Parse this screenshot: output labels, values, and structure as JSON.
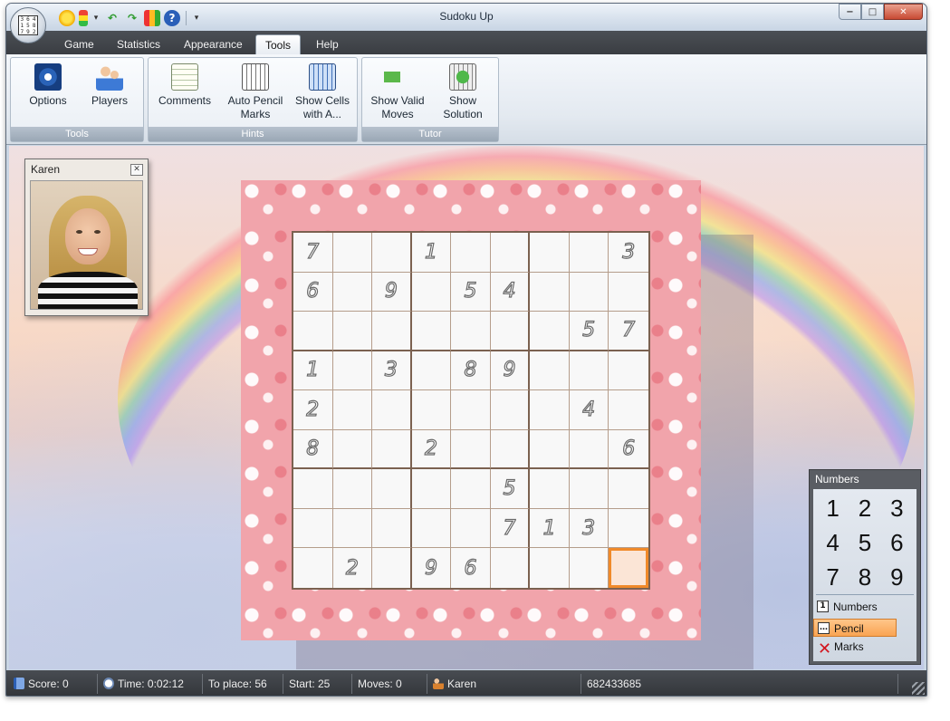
{
  "app": {
    "title": "Sudoku Up"
  },
  "quick_access": [
    "sun-icon",
    "traffic-light-icon",
    "dropdown-arrow-icon",
    "undo-icon",
    "redo-icon",
    "chart-icon",
    "help-icon",
    "customize-icon"
  ],
  "menu": {
    "tabs": [
      "Game",
      "Statistics",
      "Appearance",
      "Tools",
      "Help"
    ],
    "active": "Tools"
  },
  "ribbon": {
    "groups": [
      {
        "label": "Tools",
        "buttons": [
          {
            "label": "Options",
            "icon": "gear-icon"
          },
          {
            "label": "Players",
            "icon": "players-icon"
          }
        ]
      },
      {
        "label": "Hints",
        "buttons": [
          {
            "label": "Comments",
            "icon": "notepad-icon"
          },
          {
            "label": "Auto Pencil Marks",
            "icon": "pencil-grid-icon"
          },
          {
            "label": "Show Cells with A...",
            "icon": "cells-grid-icon"
          }
        ]
      },
      {
        "label": "Tutor",
        "buttons": [
          {
            "label": "Show Valid Moves",
            "icon": "arrow-icon"
          },
          {
            "label": "Show Solution",
            "icon": "solution-icon"
          }
        ]
      }
    ]
  },
  "player": {
    "name": "Karen"
  },
  "board": {
    "rows": [
      [
        "7",
        "",
        "",
        "1",
        "",
        "",
        "",
        "",
        "3"
      ],
      [
        "6",
        "",
        "9",
        "",
        "5",
        "4",
        "",
        "",
        ""
      ],
      [
        "",
        "",
        "",
        "",
        "",
        "",
        "",
        "5",
        "7"
      ],
      [
        "1",
        "",
        "3",
        "",
        "8",
        "9",
        "",
        "",
        ""
      ],
      [
        "2",
        "",
        "",
        "",
        "",
        "",
        "",
        "4",
        ""
      ],
      [
        "8",
        "",
        "",
        "2",
        "",
        "",
        "",
        "",
        "6"
      ],
      [
        "",
        "",
        "",
        "",
        "",
        "5",
        "",
        "",
        ""
      ],
      [
        "",
        "",
        "",
        "",
        "",
        "7",
        "1",
        "3",
        ""
      ],
      [
        "",
        "2",
        "",
        "9",
        "6",
        "",
        "",
        "",
        ""
      ]
    ],
    "selected": [
      8,
      8
    ]
  },
  "numpad": {
    "title": "Numbers",
    "keys": [
      "1",
      "2",
      "3",
      "4",
      "5",
      "6",
      "7",
      "8",
      "9"
    ],
    "mode_numbers": "Numbers",
    "mode_pencil": "Pencil Marks",
    "active_mode": "Pencil Marks"
  },
  "status": {
    "score": "Score: 0",
    "time": "Time: 0:02:12",
    "to_place": "To place: 56",
    "start": "Start: 25",
    "moves": "Moves: 0",
    "player": "Karen",
    "game_id": "682433685"
  },
  "colors": {
    "selected_cell": "#fbe5d6",
    "selected_border": "#f08a2a",
    "board_pink": "#f1a4ab",
    "pencil_active": "#f9a452"
  }
}
